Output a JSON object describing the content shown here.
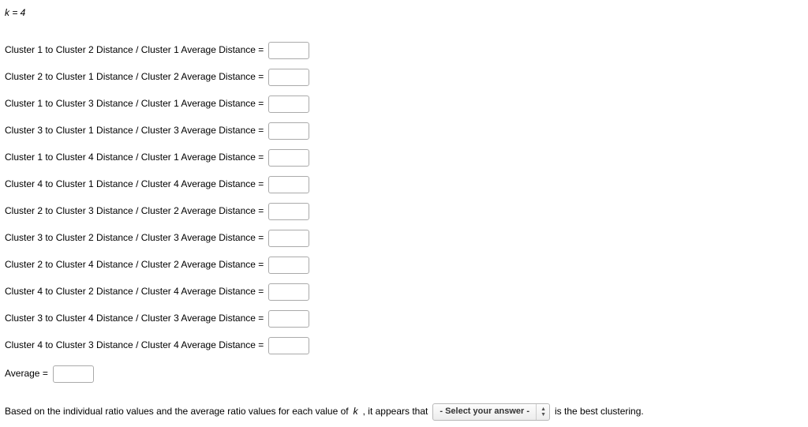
{
  "heading": "k = 4",
  "ratio_rows": [
    {
      "label": "Cluster 1 to Cluster 2 Distance / Cluster 1 Average Distance =",
      "value": ""
    },
    {
      "label": "Cluster 2 to Cluster 1 Distance / Cluster 2 Average Distance =",
      "value": ""
    },
    {
      "label": "Cluster 1 to Cluster 3 Distance / Cluster 1 Average Distance =",
      "value": ""
    },
    {
      "label": "Cluster 3 to Cluster 1 Distance / Cluster 3 Average Distance =",
      "value": ""
    },
    {
      "label": "Cluster 1 to Cluster 4 Distance / Cluster 1 Average Distance =",
      "value": ""
    },
    {
      "label": "Cluster 4 to Cluster 1 Distance / Cluster 4 Average Distance =",
      "value": ""
    },
    {
      "label": "Cluster 2 to Cluster 3 Distance / Cluster 2 Average Distance =",
      "value": ""
    },
    {
      "label": "Cluster 3 to Cluster 2 Distance / Cluster 3 Average Distance =",
      "value": ""
    },
    {
      "label": "Cluster 2 to Cluster 4 Distance / Cluster 2 Average Distance =",
      "value": ""
    },
    {
      "label": "Cluster 4 to Cluster 2 Distance / Cluster 4 Average Distance =",
      "value": ""
    },
    {
      "label": "Cluster 3 to Cluster 4 Distance / Cluster 3 Average Distance =",
      "value": ""
    },
    {
      "label": "Cluster 4 to Cluster 3 Distance / Cluster 4 Average Distance =",
      "value": ""
    }
  ],
  "average": {
    "label": "Average =",
    "value": ""
  },
  "footer": {
    "text_before": "Based on the individual ratio values and the average ratio values for each value of ",
    "kvar": "k",
    "text_mid": ", it appears that",
    "select_placeholder": "- Select your answer -",
    "text_after": "is the best clustering."
  }
}
